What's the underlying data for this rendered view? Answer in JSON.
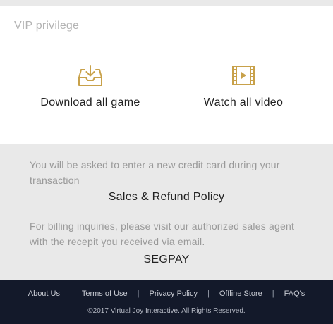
{
  "vip": {
    "title": "VIP privilege",
    "features": [
      {
        "icon": "download-tray-icon",
        "label": "Download all game"
      },
      {
        "icon": "video-film-icon",
        "label": "Watch all video"
      }
    ]
  },
  "billing": {
    "credit_note": "You will be asked to enter a new credit card during your transaction",
    "refund_link": "Sales & Refund Policy",
    "inquiry_note": "For billing inquiries, please visit our authorized sales agent with the recepit you received via email.",
    "agent_link": "SEGPAY"
  },
  "footer": {
    "links": [
      "About Us",
      "Terms of Use",
      "Privacy Policy",
      "Offline Store",
      "FAQ's"
    ],
    "separator": "|",
    "copyright": "©2017 Virtual Joy Interactive. All Rights Reserved."
  },
  "colors": {
    "accent": "#c8a14a",
    "footer_bg": "#13192a",
    "page_bg": "#e9e9e9"
  }
}
